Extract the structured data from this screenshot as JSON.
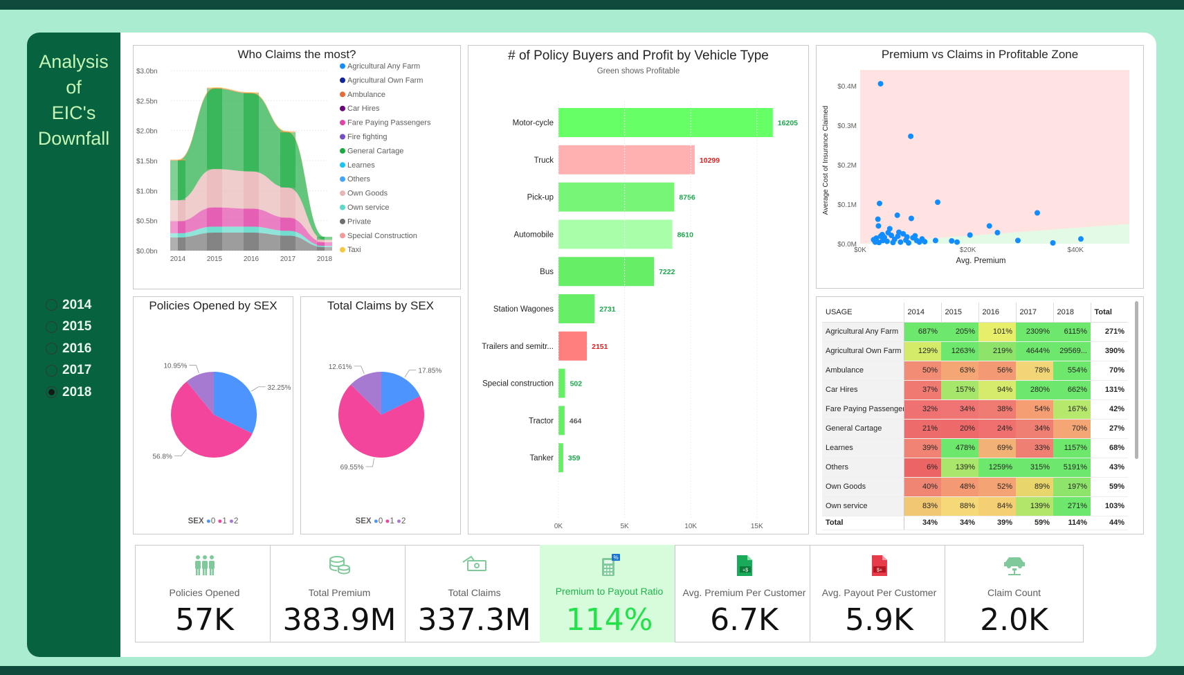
{
  "sidebar": {
    "title_lines": [
      "Analysis",
      "of",
      "EIC's",
      "Downfall"
    ],
    "years": [
      "2014",
      "2015",
      "2016",
      "2017",
      "2018"
    ],
    "selected_year": "2018"
  },
  "charts": {
    "who_claims": {
      "title": "Who Claims the most?",
      "legend": [
        "Agricultural Any Farm",
        "Agricultural Own Farm",
        "Ambulance",
        "Car Hires",
        "Fare Paying Passengers",
        "Fire fighting",
        "General Cartage",
        "Learnes",
        "Others",
        "Own Goods",
        "Own service",
        "Private",
        "Special Construction",
        "Taxi"
      ],
      "legend_colors": [
        "#118dff",
        "#12239e",
        "#e66c37",
        "#6b007b",
        "#e044a7",
        "#744ec2",
        "#1aab40",
        "#15c6f4",
        "#41a4ff",
        "#e8b5b5",
        "#5bd9c9",
        "#6f6f6f",
        "#f29b9b",
        "#f5c842"
      ]
    },
    "vehicle_type": {
      "title": "# of Policy Buyers and Profit by Vehicle Type",
      "subtitle": "Green shows Profitable"
    },
    "premium_claims": {
      "title": "Premium vs Claims in Profitable Zone",
      "xlabel": "Avg. Premium",
      "ylabel": "Average Cost of Insurance Claimed"
    },
    "policies_sex": {
      "title": "Policies Opened by SEX",
      "legend_title": "SEX",
      "legend": [
        "0",
        "1",
        "2"
      ]
    },
    "claims_sex": {
      "title": "Total Claims by SEX",
      "legend_title": "SEX",
      "legend": [
        "0",
        "1",
        "2"
      ]
    }
  },
  "chart_data": [
    {
      "id": "who_claims",
      "type": "area",
      "x": [
        2014,
        2015,
        2016,
        2017,
        2018
      ],
      "y_ticks": [
        "$0.0bn",
        "$0.5bn",
        "$1.0bn",
        "$1.5bn",
        "$2.0bn",
        "$2.5bn",
        "$3.0bn"
      ],
      "ylim": [
        0,
        3.0
      ],
      "unit": "bn",
      "series": [
        {
          "name": "Private",
          "color": "#6f6f6f",
          "values": [
            0.22,
            0.3,
            0.3,
            0.25,
            0.06
          ]
        },
        {
          "name": "Own service",
          "color": "#5bd9c9",
          "values": [
            0.07,
            0.1,
            0.1,
            0.08,
            0.02
          ]
        },
        {
          "name": "Fare Paying Passengers",
          "color": "#e044a7",
          "values": [
            0.2,
            0.32,
            0.3,
            0.22,
            0.06
          ]
        },
        {
          "name": "Own Goods",
          "color": "#e8b5b5",
          "values": [
            0.35,
            0.64,
            0.62,
            0.5,
            0.04
          ]
        },
        {
          "name": "General Cartage",
          "color": "#1aab40",
          "values": [
            0.66,
            1.34,
            1.3,
            0.92,
            0.05
          ]
        },
        {
          "name": "Ambulance",
          "color": "#e66c37",
          "values": [
            0.01,
            0.01,
            0.01,
            0.01,
            0.0
          ]
        },
        {
          "name": "Taxi",
          "color": "#f5c842",
          "values": [
            0.01,
            0.01,
            0.01,
            0.01,
            0.0
          ]
        }
      ]
    },
    {
      "id": "vehicle_type",
      "type": "bar",
      "orientation": "horizontal",
      "categories": [
        "Motor-cycle",
        "Truck",
        "Pick-up",
        "Automobile",
        "Bus",
        "Station Wagones",
        "Trailers and semitr...",
        "Special construction",
        "Tractor",
        "Tanker"
      ],
      "values": [
        16205,
        10299,
        8756,
        8610,
        7222,
        2731,
        2151,
        502,
        464,
        359
      ],
      "profitable": [
        true,
        false,
        true,
        true,
        true,
        true,
        false,
        true,
        null,
        true
      ],
      "bar_colors": [
        "#66ff66",
        "#ffb0b0",
        "#77f577",
        "#a9ffa9",
        "#66ee66",
        "#66ee66",
        "#ff7f7f",
        "#66ee66",
        "#66ee66",
        "#66ee66"
      ],
      "label_colors": [
        "#1aa64a",
        "#e02020",
        "#1aa64a",
        "#1aa64a",
        "#1aa64a",
        "#1aa64a",
        "#e02020",
        "#1aa64a",
        "#555555",
        "#1aa64a"
      ],
      "x_ticks": [
        "0K",
        "5K",
        "10K",
        "15K"
      ],
      "xlim": [
        0,
        17000
      ]
    },
    {
      "id": "premium_claims",
      "type": "scatter",
      "x_ticks": [
        "$0K",
        "$20K",
        "$40K"
      ],
      "y_ticks": [
        "$0.0M",
        "$0.1M",
        "$0.2M",
        "$0.3M",
        "$0.4M"
      ],
      "xlim": [
        0,
        50000
      ],
      "ylim": [
        0,
        0.44
      ],
      "points": [
        [
          3800,
          0.405
        ],
        [
          9400,
          0.272
        ],
        [
          3300,
          0.062
        ],
        [
          3600,
          0.102
        ],
        [
          14400,
          0.105
        ],
        [
          32900,
          0.078
        ],
        [
          29300,
          0.008
        ],
        [
          24000,
          0.045
        ],
        [
          25500,
          0.028
        ],
        [
          20400,
          0.022
        ],
        [
          41000,
          0.012
        ],
        [
          35800,
          0.002
        ],
        [
          17000,
          0.007
        ],
        [
          18000,
          0.004
        ],
        [
          14000,
          0.008
        ],
        [
          9500,
          0.064
        ],
        [
          6900,
          0.072
        ],
        [
          3400,
          0.045
        ],
        [
          5500,
          0.038
        ],
        [
          4100,
          0.023
        ],
        [
          2500,
          0.01
        ],
        [
          3000,
          0.014
        ],
        [
          3500,
          0.003
        ],
        [
          4500,
          0.016
        ],
        [
          5000,
          0.006
        ],
        [
          5800,
          0.021
        ],
        [
          6400,
          0.011
        ],
        [
          7000,
          0.019
        ],
        [
          7500,
          0.004
        ],
        [
          8000,
          0.025
        ],
        [
          8500,
          0.009
        ],
        [
          9000,
          0.002
        ],
        [
          9800,
          0.015
        ],
        [
          10500,
          0.008
        ],
        [
          11000,
          0.004
        ],
        [
          4200,
          0.008
        ],
        [
          3800,
          0.019
        ],
        [
          6100,
          0.003
        ],
        [
          7200,
          0.029
        ],
        [
          8700,
          0.017
        ],
        [
          2800,
          0.004
        ],
        [
          5200,
          0.028
        ],
        [
          10200,
          0.02
        ],
        [
          11500,
          0.012
        ],
        [
          12000,
          0.005
        ]
      ]
    },
    {
      "id": "policies_sex",
      "type": "pie",
      "categories": [
        "0",
        "1",
        "2"
      ],
      "values": [
        32.25,
        56.8,
        10.95
      ],
      "labels": [
        "32.25%",
        "56.8%",
        "10.95%"
      ],
      "colors": [
        "#4d94ff",
        "#f2459b",
        "#a77ad1"
      ]
    },
    {
      "id": "claims_sex",
      "type": "pie",
      "categories": [
        "0",
        "1",
        "2"
      ],
      "values": [
        17.85,
        69.55,
        12.61
      ],
      "labels": [
        "17.85%",
        "69.55%",
        "12.61%"
      ],
      "colors": [
        "#4d94ff",
        "#f2459b",
        "#a77ad1"
      ]
    },
    {
      "id": "usage_matrix",
      "type": "table",
      "columns": [
        "USAGE",
        "2014",
        "2015",
        "2016",
        "2017",
        "2018",
        "Total"
      ],
      "rows": [
        [
          "Agricultural Any Farm",
          "687%",
          "205%",
          "101%",
          "2309%",
          "6115%",
          "271%"
        ],
        [
          "Agricultural Own Farm",
          "129%",
          "1263%",
          "219%",
          "4644%",
          "29569...",
          "390%"
        ],
        [
          "Ambulance",
          "50%",
          "63%",
          "56%",
          "78%",
          "554%",
          "70%"
        ],
        [
          "Car Hires",
          "37%",
          "157%",
          "94%",
          "280%",
          "662%",
          "131%"
        ],
        [
          "Fare Paying Passengers",
          "32%",
          "34%",
          "38%",
          "54%",
          "167%",
          "42%"
        ],
        [
          "General Cartage",
          "21%",
          "20%",
          "24%",
          "34%",
          "70%",
          "27%"
        ],
        [
          "Learnes",
          "39%",
          "478%",
          "69%",
          "33%",
          "1157%",
          "68%"
        ],
        [
          "Others",
          "6%",
          "139%",
          "1259%",
          "315%",
          "5191%",
          "43%"
        ],
        [
          "Own Goods",
          "40%",
          "48%",
          "52%",
          "89%",
          "197%",
          "59%"
        ],
        [
          "Own service",
          "83%",
          "88%",
          "84%",
          "139%",
          "271%",
          "103%"
        ]
      ],
      "cell_colors": [
        [
          "#6de86d",
          "#6de86d",
          "#e6ee6a",
          "#6de86d",
          "#6de86d"
        ],
        [
          "#d4eb6a",
          "#6de86d",
          "#8ee46a",
          "#6de86d",
          "#6de86d"
        ],
        [
          "#f28c74",
          "#f5a675",
          "#f39a74",
          "#f2d577",
          "#6de86d"
        ],
        [
          "#f07a72",
          "#a5e66b",
          "#d6ea6b",
          "#6de86d",
          "#6de86d"
        ],
        [
          "#ef7171",
          "#ef7473",
          "#f07b73",
          "#f59e74",
          "#b6e86b"
        ],
        [
          "#ee6b6b",
          "#ee6a6a",
          "#ef706f",
          "#f07f73",
          "#f5a675"
        ],
        [
          "#f08373",
          "#6de86d",
          "#f2b275",
          "#f07f73",
          "#6de86d"
        ],
        [
          "#ec6565",
          "#aae66b",
          "#6de86d",
          "#6de86d",
          "#6de86d"
        ],
        [
          "#f08573",
          "#f39a74",
          "#f4a474",
          "#e8d56c",
          "#8fe56c"
        ],
        [
          "#f2c772",
          "#f5d877",
          "#f5cf74",
          "#b2e66b",
          "#6de86d"
        ]
      ],
      "totals": [
        "Total",
        "34%",
        "34%",
        "39%",
        "59%",
        "114%",
        "44%"
      ]
    }
  ],
  "kpis": [
    {
      "label": "Policies Opened",
      "value": "57K",
      "icon": "people-icon"
    },
    {
      "label": "Total Premium",
      "value": "383.9M",
      "icon": "coins-icon"
    },
    {
      "label": "Total Claims",
      "value": "337.3M",
      "icon": "cash-icon"
    },
    {
      "label": "Premium to Payout Ratio",
      "value": "114%",
      "icon": "calculator-icon"
    },
    {
      "label": "Avg. Premium Per Customer",
      "value": "6.7K",
      "icon": "invoice-plus-icon"
    },
    {
      "label": "Avg. Payout Per Customer",
      "value": "5.9K",
      "icon": "invoice-minus-icon"
    },
    {
      "label": "Claim Count",
      "value": "2.0K",
      "icon": "car-lift-icon"
    }
  ]
}
